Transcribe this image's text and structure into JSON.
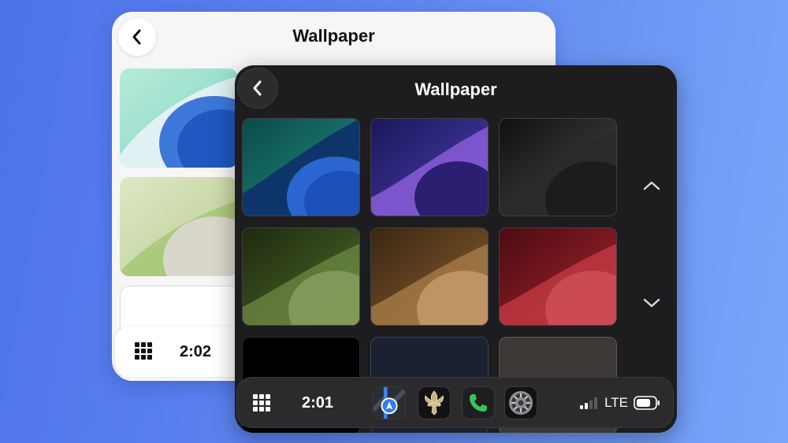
{
  "light_screen": {
    "title": "Wallpaper",
    "time": "2:02",
    "icons": {
      "back": "chevron-left-icon",
      "apps": "app-grid-icon"
    }
  },
  "dark_screen": {
    "title": "Wallpaper",
    "time": "2:01",
    "network": "LTE",
    "signal_bars": 2,
    "icons": {
      "back": "chevron-left-icon",
      "apps": "app-grid-icon",
      "scroll_up": "chevron-up-icon",
      "scroll_down": "chevron-down-icon"
    },
    "wallpapers": [
      {
        "name": "teal",
        "colors": [
          "#0c4a4a",
          "#1f8f82",
          "#1d4fb8"
        ]
      },
      {
        "name": "purple",
        "colors": [
          "#1a1858",
          "#4a3fb4",
          "#8a5cd8"
        ]
      },
      {
        "name": "graphite",
        "colors": [
          "#101010",
          "#3a3a3a",
          "#6a6a6a"
        ]
      },
      {
        "name": "olive",
        "colors": [
          "#1e2a10",
          "#4f6a2a",
          "#8aa060"
        ]
      },
      {
        "name": "bronze",
        "colors": [
          "#3a2612",
          "#8a6030",
          "#c49a6a"
        ]
      },
      {
        "name": "crimson",
        "colors": [
          "#4a0c12",
          "#a8232c",
          "#d0505a"
        ]
      },
      {
        "name": "black",
        "colors": [
          "#000000"
        ]
      },
      {
        "name": "navy",
        "colors": [
          "#1a2130"
        ]
      },
      {
        "name": "taupe",
        "colors": [
          "#3d3835"
        ]
      }
    ],
    "dock_apps": [
      {
        "name": "maps",
        "icon": "maps-icon"
      },
      {
        "name": "saints",
        "icon": "fleur-de-lis-icon"
      },
      {
        "name": "phone",
        "icon": "phone-icon"
      },
      {
        "name": "settings",
        "icon": "settings-gear-icon"
      }
    ]
  }
}
